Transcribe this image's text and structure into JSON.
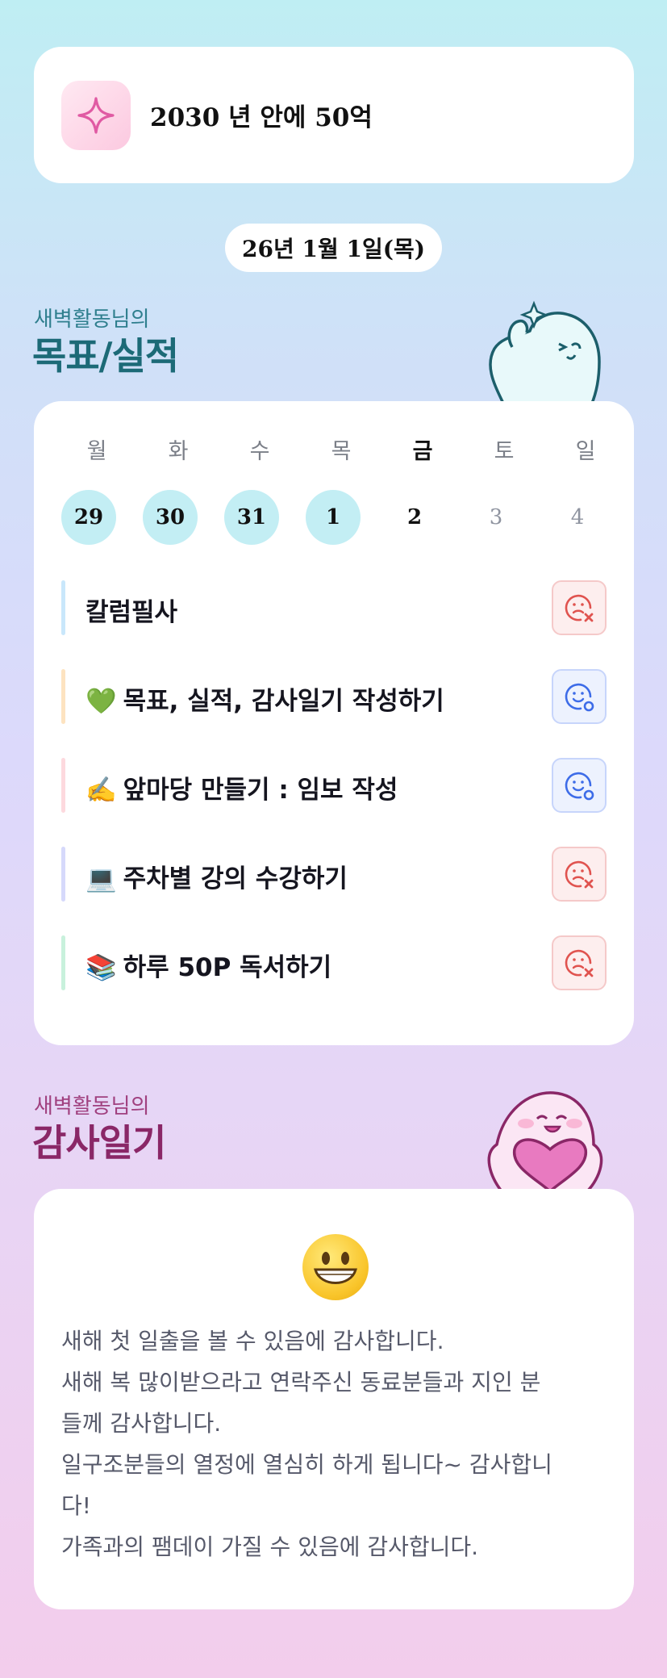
{
  "goal": {
    "icon": "sparkle-icon",
    "text": "2030 년 안에 50억"
  },
  "date_label": "26년 1월 1일(목)",
  "goals_section": {
    "subtitle": "새벽활동님의",
    "title": "목표/실적"
  },
  "week": {
    "weekdays": [
      "월",
      "화",
      "수",
      "목",
      "금",
      "토",
      "일"
    ],
    "days": [
      {
        "num": "29",
        "state": "done"
      },
      {
        "num": "30",
        "state": "done"
      },
      {
        "num": "31",
        "state": "done"
      },
      {
        "num": "1",
        "state": "done"
      },
      {
        "num": "2",
        "state": "today"
      },
      {
        "num": "3",
        "state": "future"
      },
      {
        "num": "4",
        "state": "future"
      }
    ],
    "today_index": 4
  },
  "tasks": [
    {
      "emoji": "",
      "label": "칼럼필사",
      "status": "fail",
      "bar_color": "#c9e7fb"
    },
    {
      "emoji": "💚",
      "label": "목표, 실적, 감사일기 작성하기",
      "status": "done",
      "bar_color": "#fde3c0"
    },
    {
      "emoji": "✍️",
      "label": "앞마당 만들기 : 임보 작성",
      "status": "done",
      "bar_color": "#fdd9de"
    },
    {
      "emoji": "💻",
      "label": "주차별 강의 수강하기",
      "status": "fail",
      "bar_color": "#d6d9fb"
    },
    {
      "emoji": "📚",
      "label": "하루 50P 독서하기",
      "status": "fail",
      "bar_color": "#c8f1dc"
    }
  ],
  "gratitude_section": {
    "subtitle": "새벽활동님의",
    "title": "감사일기"
  },
  "gratitude": {
    "emoji": "😀",
    "lines": [
      "새해 첫 일출을 볼 수 있음에 감사합니다.",
      "새해 복 많이받으라고 연락주신 동료분들과 지인 분",
      "들께 감사합니다.",
      "일구조분들의 열정에 열심히 하게 됩니다~ 감사합니",
      "다!",
      "가족과의 팸데이 가질 수 있음에 감사합니다."
    ]
  },
  "colors": {
    "done_day": "#c3eef4",
    "fail_icon": "#e0534f",
    "done_icon": "#3d6ce8",
    "teal_title": "#1c6a77",
    "pink_title": "#8a2767"
  }
}
